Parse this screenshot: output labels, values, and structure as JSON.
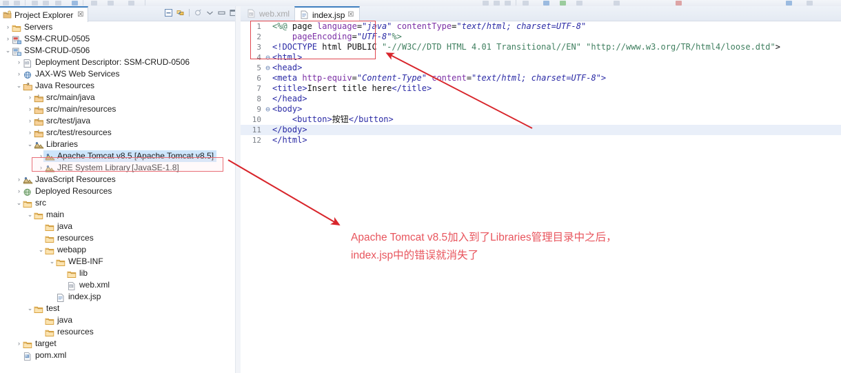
{
  "toolbar": {
    "name": "eclipse-toolbar"
  },
  "explorer": {
    "tab_label": "Project Explorer",
    "tab_close": "☒",
    "icons": [
      {
        "name": "collapse-all-icon",
        "title": "Collapse All"
      },
      {
        "name": "link-with-editor-icon",
        "title": "Link with Editor"
      },
      {
        "name": "view-menu-icon",
        "title": "View Menu"
      },
      {
        "name": "minimize-icon",
        "title": "Minimize"
      },
      {
        "name": "maximize-icon",
        "title": "Maximize"
      },
      {
        "name": "restore-icon",
        "title": "Restore"
      }
    ],
    "tree": [
      {
        "depth": 0,
        "arrow": "›",
        "icon": "folder-servers",
        "label": "Servers"
      },
      {
        "depth": 0,
        "arrow": "›",
        "icon": "project-web",
        "label": "SSM-CRUD-0505"
      },
      {
        "depth": 0,
        "arrow": "⌄",
        "icon": "project-web-open",
        "label": "SSM-CRUD-0506"
      },
      {
        "depth": 1,
        "arrow": "›",
        "icon": "deployment-descriptor",
        "label": "Deployment Descriptor: SSM-CRUD-0506"
      },
      {
        "depth": 1,
        "arrow": "›",
        "icon": "web-services",
        "label": "JAX-WS Web Services"
      },
      {
        "depth": 1,
        "arrow": "⌄",
        "icon": "java-resources",
        "label": "Java Resources"
      },
      {
        "depth": 2,
        "arrow": "›",
        "icon": "source-folder",
        "label": "src/main/java"
      },
      {
        "depth": 2,
        "arrow": "›",
        "icon": "source-folder",
        "label": "src/main/resources"
      },
      {
        "depth": 2,
        "arrow": "›",
        "icon": "source-folder",
        "label": "src/test/java"
      },
      {
        "depth": 2,
        "arrow": "›",
        "icon": "source-folder",
        "label": "src/test/resources"
      },
      {
        "depth": 2,
        "arrow": "⌄",
        "icon": "library",
        "label": "Libraries"
      },
      {
        "depth": 3,
        "arrow": "›",
        "icon": "library",
        "label": "Apache Tomcat v8.5 [Apache Tomcat v8.5]",
        "selected": true
      },
      {
        "depth": 3,
        "arrow": "›",
        "icon": "library",
        "label": "JRE System Library ",
        "label_dim": "[JavaSE-1.8]"
      },
      {
        "depth": 1,
        "arrow": "›",
        "icon": "library",
        "label": "JavaScript Resources"
      },
      {
        "depth": 1,
        "arrow": "›",
        "icon": "deployed-resources",
        "label": "Deployed Resources"
      },
      {
        "depth": 1,
        "arrow": "⌄",
        "icon": "folder",
        "label": "src"
      },
      {
        "depth": 2,
        "arrow": "⌄",
        "icon": "folder",
        "label": "main"
      },
      {
        "depth": 3,
        "arrow": "",
        "icon": "folder",
        "label": "java"
      },
      {
        "depth": 3,
        "arrow": "",
        "icon": "folder",
        "label": "resources"
      },
      {
        "depth": 3,
        "arrow": "⌄",
        "icon": "folder",
        "label": "webapp"
      },
      {
        "depth": 4,
        "arrow": "⌄",
        "icon": "folder",
        "label": "WEB-INF"
      },
      {
        "depth": 5,
        "arrow": "",
        "icon": "folder",
        "label": "lib"
      },
      {
        "depth": 5,
        "arrow": "",
        "icon": "xml-file",
        "label": "web.xml"
      },
      {
        "depth": 4,
        "arrow": "",
        "icon": "jsp-file",
        "label": "index.jsp"
      },
      {
        "depth": 2,
        "arrow": "⌄",
        "icon": "folder",
        "label": "test"
      },
      {
        "depth": 3,
        "arrow": "",
        "icon": "folder",
        "label": "java"
      },
      {
        "depth": 3,
        "arrow": "",
        "icon": "folder",
        "label": "resources"
      },
      {
        "depth": 1,
        "arrow": "›",
        "icon": "folder",
        "label": "target"
      },
      {
        "depth": 1,
        "arrow": "",
        "icon": "maven-file",
        "label": "pom.xml"
      }
    ]
  },
  "editor": {
    "tabs": [
      {
        "label": "web.xml",
        "icon": "xml-file",
        "active": false,
        "close": ""
      },
      {
        "label": "index.jsp",
        "icon": "jsp-file",
        "active": true,
        "close": "☒"
      }
    ],
    "lines": [
      {
        "n": "1",
        "fold": "",
        "cur": false,
        "tokens": [
          {
            "t": "<%@ ",
            "c": "t-dir"
          },
          {
            "t": "page ",
            "c": "t-plain"
          },
          {
            "t": "language",
            "c": "t-attr"
          },
          {
            "t": "=",
            "c": "t-plain"
          },
          {
            "t": "\"java\"",
            "c": "t-val"
          },
          {
            "t": " ",
            "c": "t-plain"
          },
          {
            "t": "contentType",
            "c": "t-attr"
          },
          {
            "t": "=",
            "c": "t-plain"
          },
          {
            "t": "\"text/html; charset=UTF-8\"",
            "c": "t-val"
          }
        ]
      },
      {
        "n": "2",
        "fold": "",
        "cur": false,
        "tokens": [
          {
            "t": "    ",
            "c": "t-plain"
          },
          {
            "t": "pageEncoding",
            "c": "t-attr"
          },
          {
            "t": "=",
            "c": "t-plain"
          },
          {
            "t": "\"UTF-8\"",
            "c": "t-val"
          },
          {
            "t": "%>",
            "c": "t-dir"
          }
        ]
      },
      {
        "n": "3",
        "fold": "",
        "cur": false,
        "tokens": [
          {
            "t": "<!DOCTYPE ",
            "c": "t-tag"
          },
          {
            "t": "html ",
            "c": "t-plain"
          },
          {
            "t": "PUBLIC ",
            "c": "t-plain"
          },
          {
            "t": "\"-//W3C//DTD HTML 4.01 Transitional//EN\"",
            "c": "t-doctype"
          },
          {
            "t": " ",
            "c": "t-plain"
          },
          {
            "t": "\"http://www.w3.org/TR/html4/loose.dtd\"",
            "c": "t-doctype"
          },
          {
            "t": ">",
            "c": "t-plain"
          }
        ]
      },
      {
        "n": "4",
        "fold": "⊖",
        "cur": false,
        "tokens": [
          {
            "t": "<html>",
            "c": "t-tag"
          }
        ]
      },
      {
        "n": "5",
        "fold": "⊖",
        "cur": false,
        "tokens": [
          {
            "t": "<head>",
            "c": "t-tag"
          }
        ]
      },
      {
        "n": "6",
        "fold": "",
        "cur": false,
        "tokens": [
          {
            "t": "<meta ",
            "c": "t-tag"
          },
          {
            "t": "http-equiv",
            "c": "t-attr"
          },
          {
            "t": "=",
            "c": "t-plain"
          },
          {
            "t": "\"Content-Type\"",
            "c": "t-val"
          },
          {
            "t": " ",
            "c": "t-plain"
          },
          {
            "t": "content",
            "c": "t-attr"
          },
          {
            "t": "=",
            "c": "t-plain"
          },
          {
            "t": "\"text/html; charset=UTF-8\"",
            "c": "t-val"
          },
          {
            "t": ">",
            "c": "t-tag"
          }
        ]
      },
      {
        "n": "7",
        "fold": "",
        "cur": false,
        "tokens": [
          {
            "t": "<title>",
            "c": "t-tag"
          },
          {
            "t": "Insert title here",
            "c": "t-txt"
          },
          {
            "t": "</title>",
            "c": "t-tag"
          }
        ]
      },
      {
        "n": "8",
        "fold": "",
        "cur": false,
        "tokens": [
          {
            "t": "</head>",
            "c": "t-tag"
          }
        ]
      },
      {
        "n": "9",
        "fold": "⊖",
        "cur": false,
        "tokens": [
          {
            "t": "<body>",
            "c": "t-tag"
          }
        ]
      },
      {
        "n": "10",
        "fold": "",
        "cur": false,
        "tokens": [
          {
            "t": "    ",
            "c": "t-plain"
          },
          {
            "t": "<button>",
            "c": "t-tag"
          },
          {
            "t": "按钮",
            "c": "t-txt"
          },
          {
            "t": "</button>",
            "c": "t-tag"
          }
        ]
      },
      {
        "n": "11",
        "fold": "",
        "cur": true,
        "tokens": [
          {
            "t": "</body>",
            "c": "t-tag"
          }
        ]
      },
      {
        "n": "12",
        "fold": "",
        "cur": false,
        "tokens": [
          {
            "t": "</html>",
            "c": "t-tag"
          }
        ]
      }
    ]
  },
  "annotations": {
    "note_line1": "Apache Tomcat v8.5加入到了Libraries管理目录中之后，",
    "note_line2": "index.jsp中的错误就消失了",
    "note_color": "#e8555d",
    "box_color": "#e0464f",
    "arrow_color": "#d8252b"
  }
}
